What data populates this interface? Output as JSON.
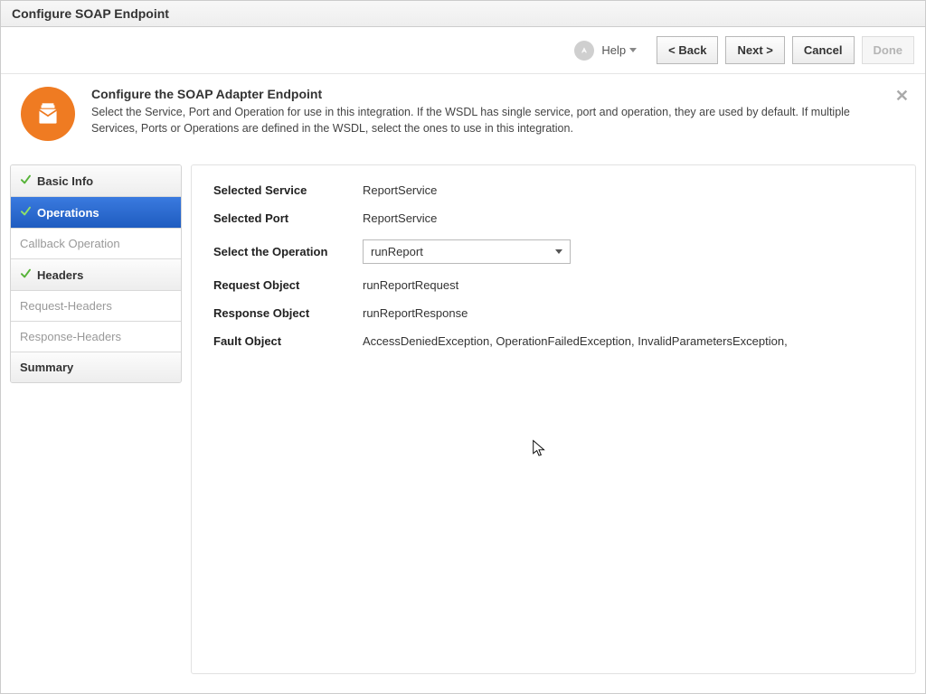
{
  "window": {
    "title": "Configure SOAP Endpoint"
  },
  "toolbar": {
    "help": "Help",
    "back": "<  Back",
    "next": "Next  >",
    "cancel": "Cancel",
    "done": "Done"
  },
  "intro": {
    "heading": "Configure the SOAP Adapter Endpoint",
    "text": "Select the Service, Port and Operation for use in this integration. If the WSDL has single service, port and operation, they are used by default. If multiple Services, Ports or Operations are defined in the WSDL, select the ones to use in this integration."
  },
  "sidebar": {
    "basic_info": "Basic Info",
    "operations": "Operations",
    "callback": "Callback Operation",
    "headers": "Headers",
    "req_headers": "Request-Headers",
    "resp_headers": "Response-Headers",
    "summary": "Summary"
  },
  "form": {
    "selected_service_label": "Selected Service",
    "selected_service_value": "ReportService",
    "selected_port_label": "Selected Port",
    "selected_port_value": "ReportService",
    "select_operation_label": "Select the Operation",
    "select_operation_value": "runReport",
    "request_object_label": "Request Object",
    "request_object_value": "runReportRequest",
    "response_object_label": "Response Object",
    "response_object_value": "runReportResponse",
    "fault_object_label": "Fault Object",
    "fault_object_value": "AccessDeniedException, OperationFailedException, InvalidParametersException,"
  }
}
